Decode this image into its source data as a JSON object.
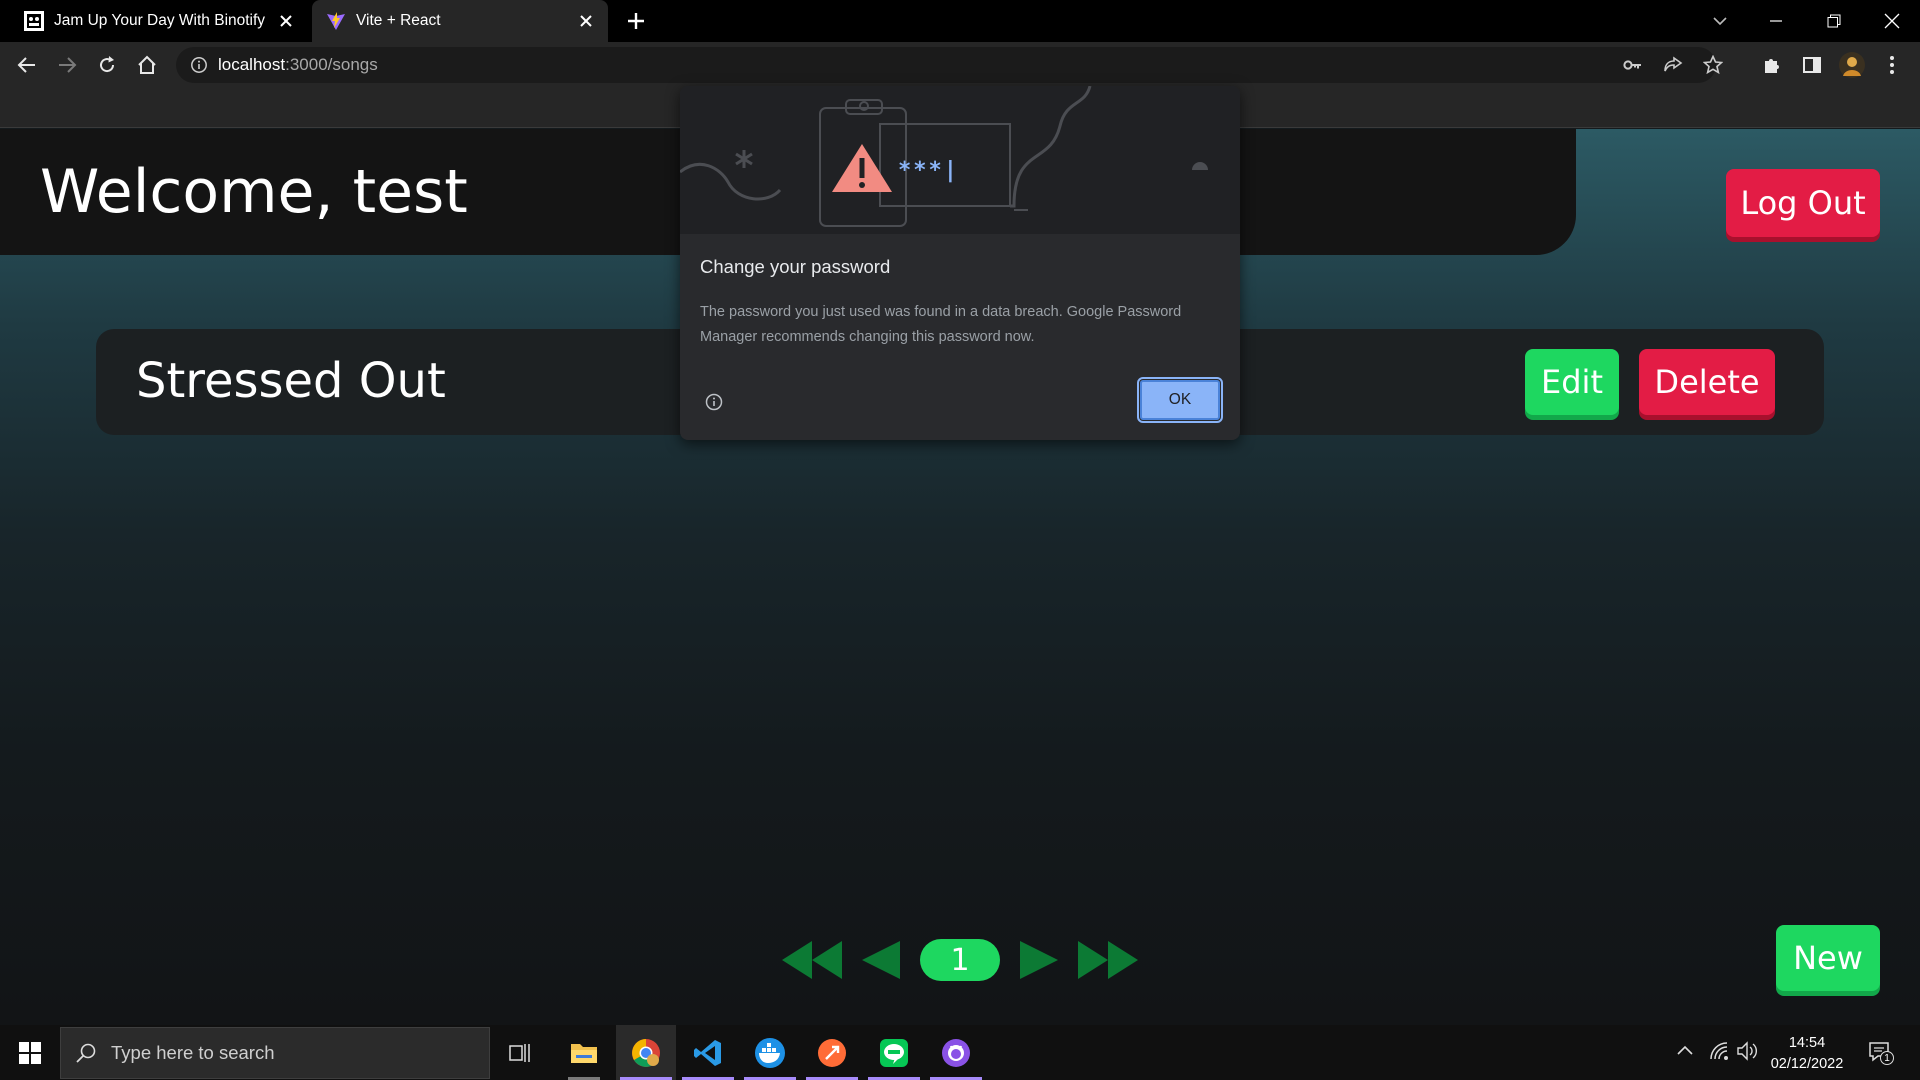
{
  "browser": {
    "tabs": [
      {
        "title": "Jam Up Your Day With Binotify",
        "active": false
      },
      {
        "title": "Vite + React",
        "active": true
      }
    ],
    "url_host": "localhost",
    "url_path": ":3000/songs"
  },
  "page": {
    "welcome": "Welcome, test",
    "logout_label": "Log Out",
    "songs": [
      {
        "title": "Stressed Out",
        "edit_label": "Edit",
        "delete_label": "Delete"
      }
    ],
    "pagination": {
      "current_page": "1"
    },
    "new_label": "New",
    "colors": {
      "green": "#1ed760",
      "red": "#e31c45"
    }
  },
  "dialog": {
    "title": "Change your password",
    "body": "The password you just used was found in a data breach. Google Password Manager recommends changing this password now.",
    "ok_label": "OK",
    "illustration_text": "***|"
  },
  "taskbar": {
    "search_placeholder": "Type here to search",
    "time": "14:54",
    "date": "02/12/2022",
    "notification_count": "1",
    "apps": [
      "task-view",
      "file-explorer",
      "chrome",
      "vscode",
      "docker",
      "postman",
      "line",
      "github-desktop"
    ]
  }
}
